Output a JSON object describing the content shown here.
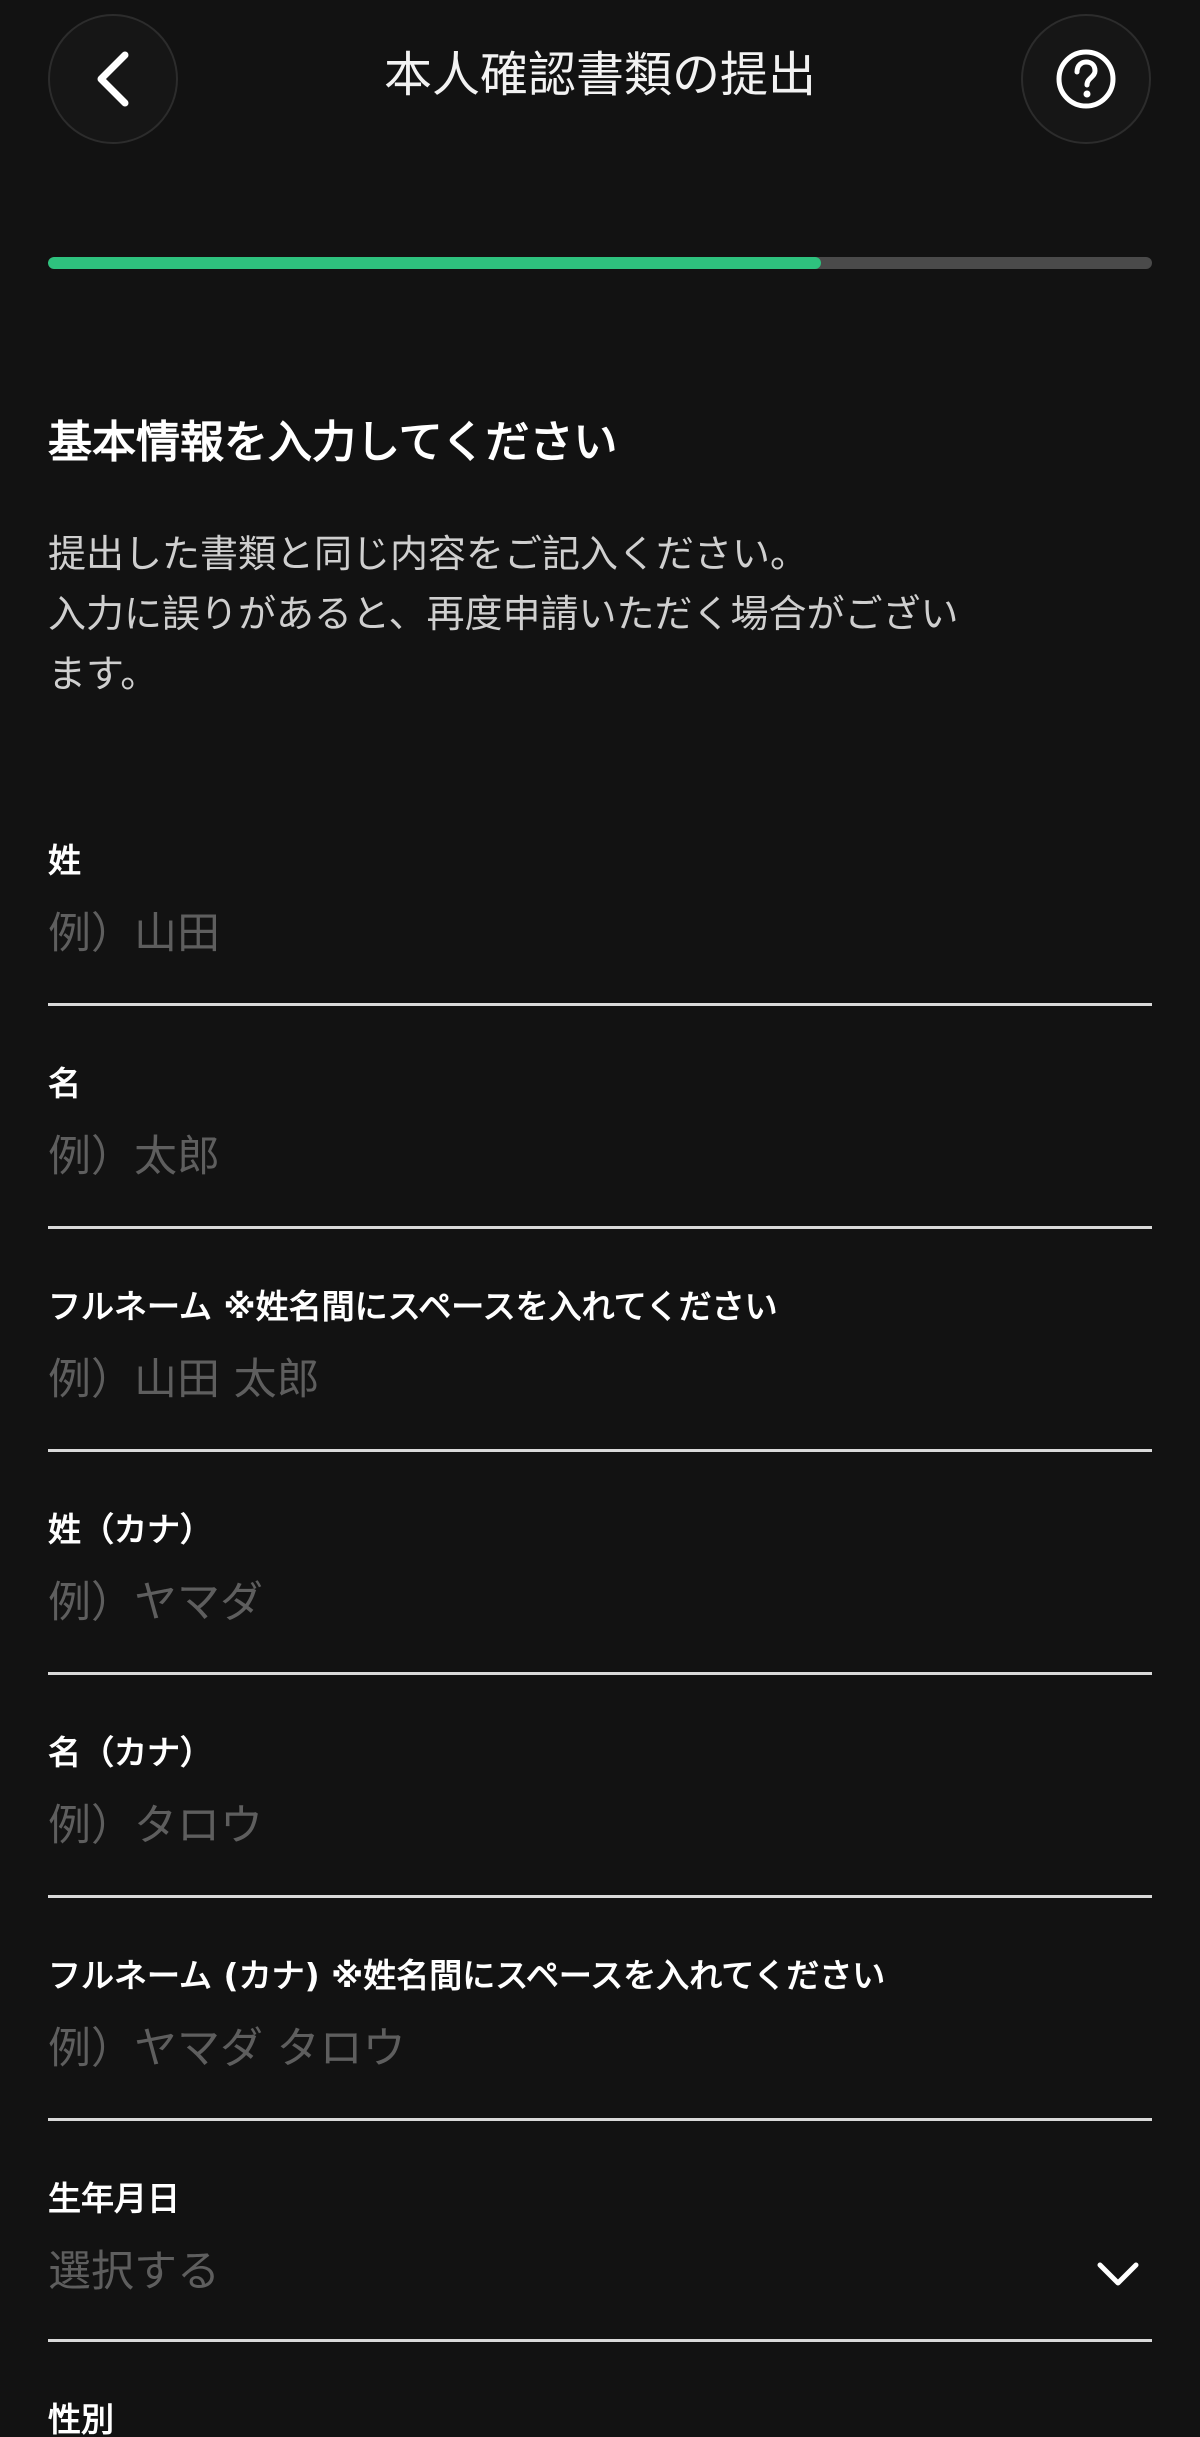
{
  "header": {
    "title": "本人確認書類の提出",
    "back_icon": "chevron-left-icon",
    "help_icon": "question-circle-icon"
  },
  "progress": {
    "fraction": 0.7,
    "fill_color": "#2ec27e",
    "track_color": "#4a4a4a"
  },
  "section": {
    "title": "基本情報を入力してください",
    "description_lines": [
      "提出した書類と同じ内容をご記入ください。",
      "入力に誤りがあると、再度申請いただく場合がござい",
      "ます。"
    ]
  },
  "fields": [
    {
      "label": "姓",
      "value": "",
      "placeholder": "例）山田"
    },
    {
      "label": "名",
      "value": "",
      "placeholder": "例）太郎"
    },
    {
      "label": "フルネーム ※姓名間にスペースを入れてください",
      "value": "",
      "placeholder": "例）山田 太郎"
    },
    {
      "label": "姓（カナ）",
      "value": "",
      "placeholder": "例）ヤマダ"
    },
    {
      "label": "名（カナ）",
      "value": "",
      "placeholder": "例）タロウ"
    },
    {
      "label": "フルネーム (カナ) ※姓名間にスペースを入れてください",
      "value": "",
      "placeholder": "例）ヤマダ タロウ"
    }
  ],
  "birthdate": {
    "label": "生年月日",
    "selected": "選択する",
    "icon": "chevron-down-icon"
  },
  "gender": {
    "label": "性別"
  }
}
